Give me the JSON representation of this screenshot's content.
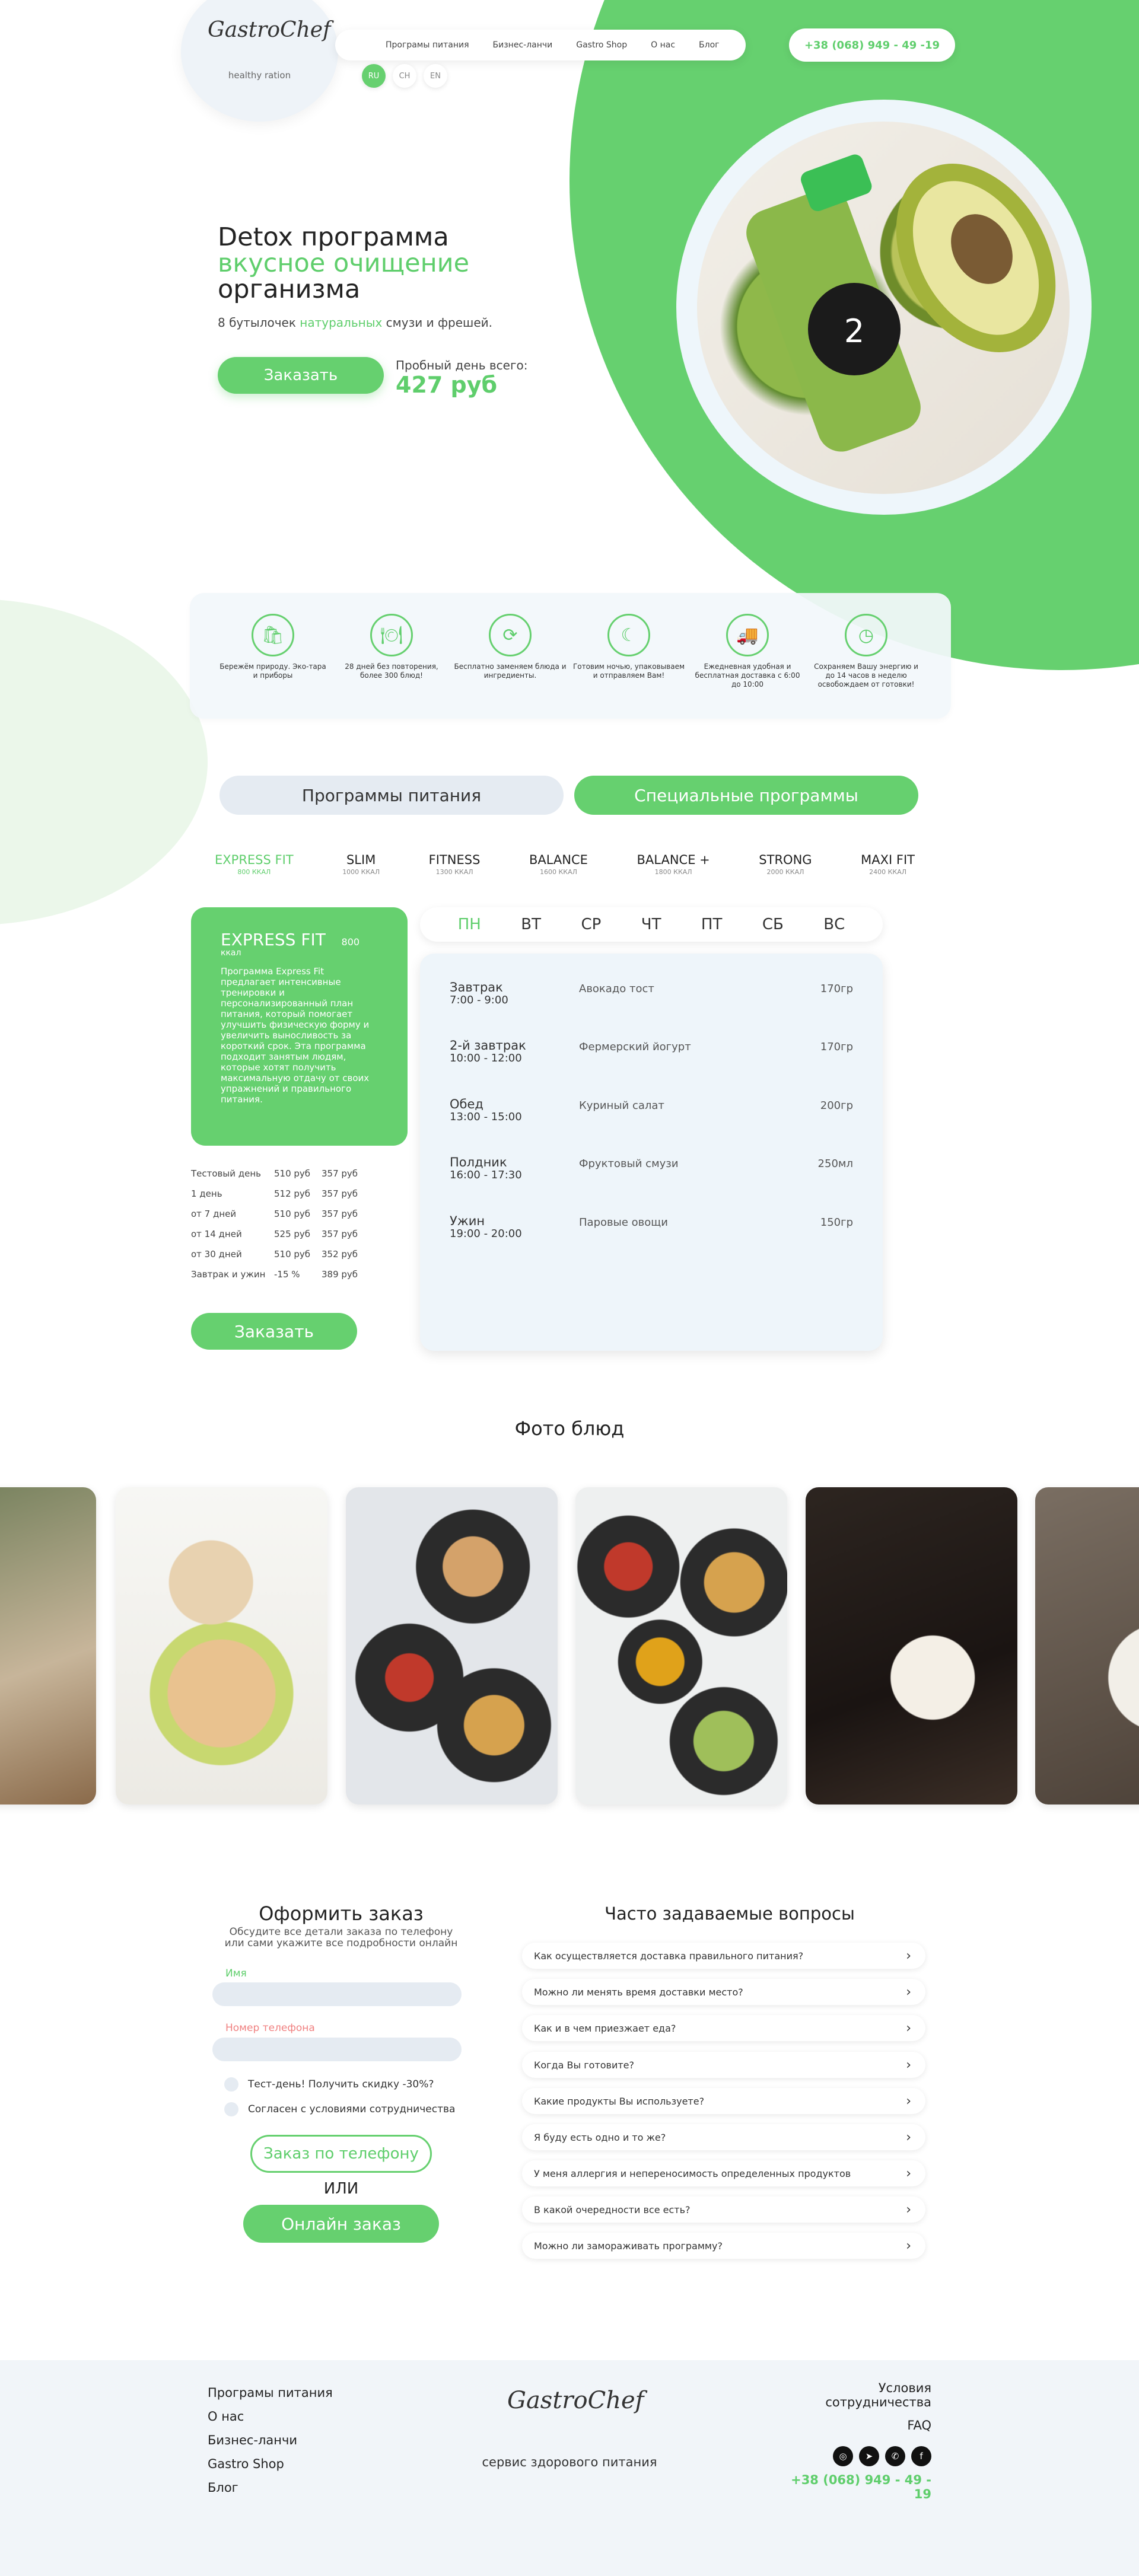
{
  "colors": {
    "accent": "#66d06f",
    "pale": "#eef5fa",
    "inputs": "#e5ebf2",
    "name_label": "#5fce6c",
    "phone_label": "#f08080"
  },
  "header": {
    "logo": "GastroChef",
    "logo_sub": "healthy ration",
    "nav": [
      "Програмы питания",
      "Бизнес-ланчи",
      "Gastro Shop",
      "О нас",
      "Блог"
    ],
    "phone": "+38 (068) 949 - 49 -19",
    "langs": [
      {
        "code": "RU",
        "active": true
      },
      {
        "code": "CH",
        "active": false
      },
      {
        "code": "EN",
        "active": false
      }
    ]
  },
  "hero": {
    "line1": "Detox программа",
    "line2": "вкусное очищение",
    "line3": "организма",
    "desc_before": "8 бутылочек ",
    "desc_highlight": "натуральных",
    "desc_after": " смузи и фрешей.",
    "order_button": "Заказать",
    "trial_label": "Пробный день всего:",
    "trial_price": "427 руб",
    "slider": {
      "prev": "‹",
      "next": "›",
      "active_index": 0,
      "count": 3
    }
  },
  "features": [
    {
      "icon": "bag-icon",
      "glyph": "🛍",
      "text": "Бережём природу. Эко-тара и приборы"
    },
    {
      "icon": "cloche-icon",
      "glyph": "🍽",
      "text": "28 дней без повторения, более 300 блюд!"
    },
    {
      "icon": "swap-icon",
      "glyph": "⟳",
      "text": "Бесплатно заменяем блюда и ингредиенты."
    },
    {
      "icon": "night-cooking-icon",
      "glyph": "☾",
      "text": "Готовим ночью, упаковываем и отправляем Вам!"
    },
    {
      "icon": "delivery-truck-icon",
      "glyph": "🚚",
      "text": "Ежедневная удобная и бесплатная доставка с 6:00 до 10:00"
    },
    {
      "icon": "clock-icon",
      "glyph": "◷",
      "text": "Сохраняем Вашу энергию и до 14 часов в неделю освобождаем от готовки!"
    }
  ],
  "program_tabs": {
    "left": "Программы питания",
    "right": "Специальные программы"
  },
  "plans": [
    {
      "name": "EXPRESS FIT",
      "kcal": "800 ККАЛ",
      "active": true
    },
    {
      "name": "SLIM",
      "kcal": "1000 ККАЛ",
      "active": false
    },
    {
      "name": "FITNESS",
      "kcal": "1300 ККАЛ",
      "active": false
    },
    {
      "name": "BALANCE",
      "kcal": "1600 ККАЛ",
      "active": false
    },
    {
      "name": "BALANCE +",
      "kcal": "1800 ККАЛ",
      "active": false
    },
    {
      "name": "STRONG",
      "kcal": "2000 ККАЛ",
      "active": false
    },
    {
      "name": "MAXI FIT",
      "kcal": "2400 ККАЛ",
      "active": false
    }
  ],
  "program_card": {
    "title": "EXPRESS FIT",
    "kcal": "800",
    "unit": "ккал",
    "text": "Программа Express Fit предлагает интенсивные тренировки и персонализированный план питания, который помогает улучшить физическую форму и увеличить выносливость за короткий срок. Эта программа подходит занятым людям, которые хотят получить максимальную отдачу от своих упражнений и правильного питания."
  },
  "prices": [
    [
      "Тестовый день",
      "510 руб",
      "357 руб"
    ],
    [
      "1 день",
      "512 руб",
      "357 руб"
    ],
    [
      "от 7 дней",
      "510 руб",
      "357 руб"
    ],
    [
      "от 14 дней",
      "525 руб",
      "357 руб"
    ],
    [
      "от 30 дней",
      "510 руб",
      "352 руб"
    ],
    [
      "Завтрак и ужин",
      "-15 %",
      "389 руб"
    ]
  ],
  "order_button2": "Заказать",
  "days": [
    {
      "label": "ПН",
      "active": true
    },
    {
      "label": "ВТ",
      "active": false
    },
    {
      "label": "СР",
      "active": false
    },
    {
      "label": "ЧТ",
      "active": false
    },
    {
      "label": "ПТ",
      "active": false
    },
    {
      "label": "СБ",
      "active": false
    },
    {
      "label": "ВС",
      "active": false
    }
  ],
  "meals": [
    {
      "name": "Завтрак",
      "time": "7:00 - 9:00",
      "dish": "Авокадо тост",
      "weight": "170гр"
    },
    {
      "name": "2-й завтрак",
      "time": "10:00 - 12:00",
      "dish": "Фермерский йогурт",
      "weight": "170гр"
    },
    {
      "name": "Обед",
      "time": "13:00 - 15:00",
      "dish": "Куриный салат",
      "weight": "200гр"
    },
    {
      "name": "Полдник",
      "time": "16:00 - 17:30",
      "dish": "Фруктовый смузи",
      "weight": "250мл"
    },
    {
      "name": "Ужин",
      "time": "19:00 - 20:00",
      "dish": "Паровые овощи",
      "weight": "150гр"
    }
  ],
  "photos_title": "Фото блюд",
  "order_form": {
    "title": "Оформить заказ",
    "subtitle_1": "Обсудите все детали заказа по телефону",
    "subtitle_2": "или сами укажите все подробности онлайн",
    "name_label": "Имя",
    "phone_label": "Номер телефона",
    "check1": "Тест-день! Получить скидку -30%?",
    "check2": "Согласен с условиями сотрудничества",
    "phone_button": "Заказ по телефону",
    "or": "ИЛИ",
    "online_button": "Онлайн заказ"
  },
  "faq": {
    "title": "Часто задаваемые вопросы",
    "arrow": "›",
    "items": [
      "Как осуществляется доставка правильного питания?",
      "Можно ли менять время доставки место?",
      "Как и в чем приезжает еда?",
      "Когда Вы готовите?",
      "Какие продукты Вы используете?",
      "Я буду есть одно и то же?",
      "У меня аллергия и непереносимость определенных продуктов",
      "В какой очередности все есть?",
      "Можно ли замораживать программу?"
    ]
  },
  "footer": {
    "nav": [
      "Програмы питания",
      "О нас",
      "Бизнес-ланчи",
      "Gastro Shop",
      "Блог"
    ],
    "logo": "GastroChef",
    "slogan": "сервис здорового питания",
    "terms_1": "Условия",
    "terms_2": "сотрудничества",
    "faq_link": "FAQ",
    "socials": [
      {
        "icon": "instagram-icon",
        "glyph": "◎"
      },
      {
        "icon": "telegram-icon",
        "glyph": "➤"
      },
      {
        "icon": "viber-icon",
        "glyph": "✆"
      },
      {
        "icon": "facebook-icon",
        "glyph": "f"
      }
    ],
    "phone": "+38 (068) 949 - 49 - 19"
  }
}
